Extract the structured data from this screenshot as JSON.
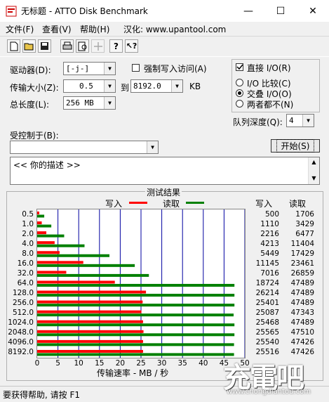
{
  "window": {
    "title": "无标题 - ATTO Disk Benchmark",
    "minimize": "—",
    "maximize": "☐",
    "close": "✕"
  },
  "menu": [
    {
      "label": "文件(F)"
    },
    {
      "label": "查看(V)"
    },
    {
      "label": "帮助(H)"
    },
    {
      "label": "汉化: www.upantool.com"
    }
  ],
  "toolbar": [
    "new-icon",
    "open-icon",
    "save-icon",
    "print-icon",
    "print-preview-icon",
    "move-icon",
    "about-icon",
    "context-help-icon"
  ],
  "form": {
    "drive_label": "驱动器(D):",
    "drive_value": "[-j-]",
    "force_write_label": "强制写入访问(A)",
    "transfer_label": "传输大小(Z):",
    "transfer_from": "0.5",
    "to_label": "到",
    "transfer_to": "8192.0",
    "kb": "KB",
    "total_label": "总长度(L):",
    "total_value": "256 MB",
    "direct_io_label": "直接 I/O(R)",
    "io_compare_label": "I/O 比较(C)",
    "overlap_io_label": "交叠 I/O(O)",
    "neither_label": "两者都不(N)",
    "queue_label": "队列深度(Q):",
    "queue_value": "4",
    "controlled_label": "受控制于(B):",
    "controlled_value": "",
    "start_label": "开始(S)",
    "description": "<<  你的描述  >>"
  },
  "results": {
    "title": "测试结果",
    "legend_write": "写入",
    "legend_read": "读取",
    "col_write": "写入",
    "col_read": "读取",
    "xlabel": "传输速率 - MB / 秒",
    "colors": {
      "write": "#ff0000",
      "read": "#008000",
      "grid": "#0000a0"
    }
  },
  "chart_data": {
    "type": "bar",
    "orientation": "horizontal",
    "title": "测试结果",
    "xlabel": "传输速率 - MB / 秒",
    "xlim": [
      0,
      50
    ],
    "xticks": [
      0,
      5,
      10,
      15,
      20,
      25,
      30,
      35,
      40,
      45,
      50
    ],
    "categories": [
      "0.5",
      "1.0",
      "2.0",
      "4.0",
      "8.0",
      "16.0",
      "32.0",
      "64.0",
      "128.0",
      "256.0",
      "512.0",
      "1024.0",
      "2048.0",
      "4096.0",
      "8192.0"
    ],
    "series": [
      {
        "name": "写入",
        "values": [
          500,
          1110,
          2216,
          4213,
          5449,
          11145,
          7016,
          18724,
          26214,
          25401,
          25087,
          25468,
          25565,
          25540,
          25516
        ],
        "bar_mbps": [
          0.5,
          1.1,
          2.2,
          4.2,
          5.4,
          11.1,
          7.0,
          18.7,
          26.2,
          25.4,
          25.1,
          25.5,
          25.6,
          25.5,
          25.5
        ]
      },
      {
        "name": "读取",
        "values": [
          1706,
          3429,
          6477,
          11404,
          17429,
          23461,
          26859,
          47489,
          47489,
          47489,
          47343,
          47489,
          47510,
          47426,
          47426
        ],
        "bar_mbps": [
          1.7,
          3.4,
          6.5,
          11.4,
          17.4,
          23.5,
          26.9,
          47.5,
          47.5,
          47.5,
          47.3,
          47.5,
          47.5,
          47.4,
          47.4
        ]
      }
    ]
  },
  "status": "要获得帮助, 请按 F1",
  "watermark": {
    "big": "充電吧",
    "small": "www.chongdiantou.com"
  }
}
